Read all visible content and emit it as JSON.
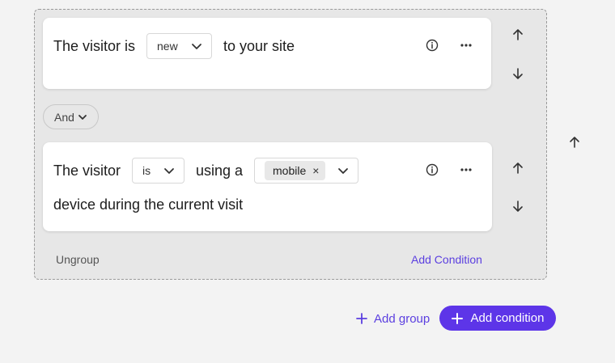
{
  "colors": {
    "accent": "#5d35e8",
    "link": "#5b3fe0",
    "group_bg": "#e7e7e7",
    "card_bg": "#ffffff"
  },
  "condition1": {
    "text_before": "The visitor is",
    "select_value": "new",
    "text_after": "to your site",
    "info_icon": "info-icon",
    "more_icon": "more-horizontal-icon"
  },
  "condition2": {
    "text_before": "The visitor",
    "select_value": "is",
    "text_middle": "using a",
    "chip_value": "mobile",
    "chip_remove": "×",
    "text_after": "device during the current visit",
    "info_icon": "info-icon",
    "more_icon": "more-horizontal-icon"
  },
  "operator": {
    "label": "And"
  },
  "group_footer": {
    "ungroup_label": "Ungroup",
    "add_condition_label": "Add Condition"
  },
  "actions": {
    "add_group_label": "Add group",
    "add_condition_label": "Add condition"
  }
}
